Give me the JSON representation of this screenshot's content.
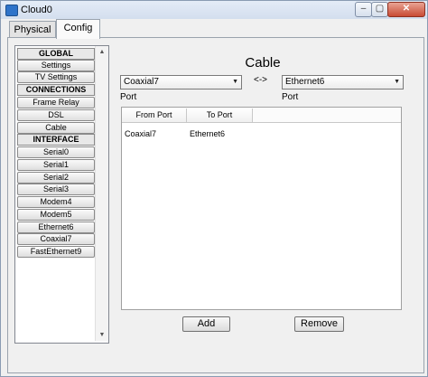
{
  "window": {
    "title": "Cloud0",
    "controls": {
      "minimize": "‒",
      "maximize": "▢",
      "close": "✕"
    }
  },
  "tabs": [
    {
      "label": "Physical"
    },
    {
      "label": "Config"
    }
  ],
  "sidebar": {
    "items": [
      {
        "label": "GLOBAL",
        "type": "header"
      },
      {
        "label": "Settings",
        "type": "button"
      },
      {
        "label": "TV Settings",
        "type": "button"
      },
      {
        "label": "CONNECTIONS",
        "type": "header"
      },
      {
        "label": "Frame Relay",
        "type": "button"
      },
      {
        "label": "DSL",
        "type": "button"
      },
      {
        "label": "Cable",
        "type": "button"
      },
      {
        "label": "INTERFACE",
        "type": "header"
      },
      {
        "label": "Serial0",
        "type": "button"
      },
      {
        "label": "Serial1",
        "type": "button"
      },
      {
        "label": "Serial2",
        "type": "button"
      },
      {
        "label": "Serial3",
        "type": "button"
      },
      {
        "label": "Modem4",
        "type": "button"
      },
      {
        "label": "Modem5",
        "type": "button"
      },
      {
        "label": "Ethernet6",
        "type": "button"
      },
      {
        "label": "Coaxial7",
        "type": "button"
      },
      {
        "label": "FastEthernet9",
        "type": "button"
      }
    ]
  },
  "main": {
    "heading": "Cable",
    "left_select": {
      "value": "Coaxial7"
    },
    "right_select": {
      "value": "Ethernet6"
    },
    "swap_label": "<->",
    "left_port_label": "Port",
    "right_port_label": "Port",
    "table": {
      "headers": [
        "From Port",
        "To Port"
      ],
      "rows": [
        {
          "from": "Coaxial7",
          "to": "Ethernet6"
        }
      ]
    },
    "add_label": "Add",
    "remove_label": "Remove"
  }
}
